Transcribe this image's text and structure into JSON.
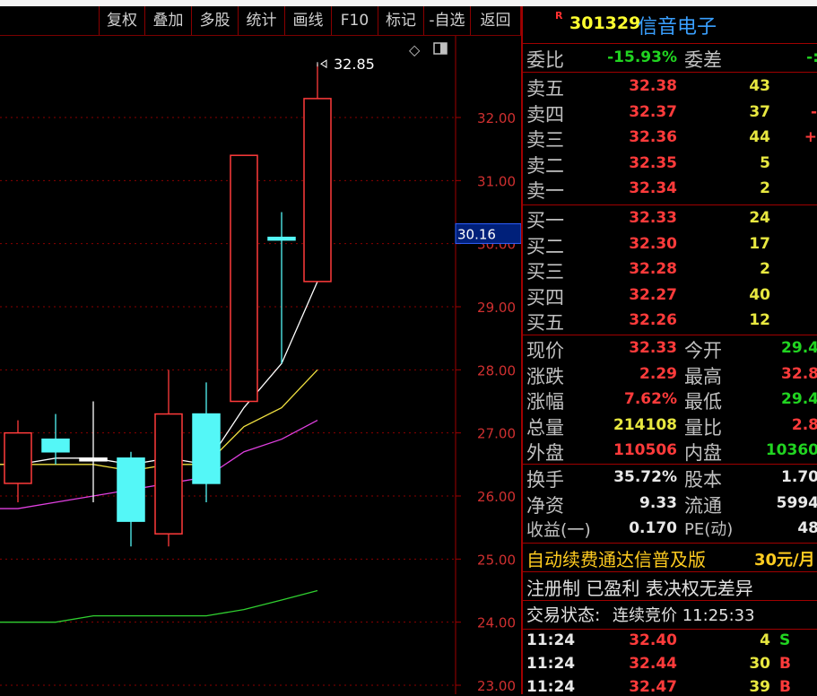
{
  "toolbar": [
    "复权",
    "叠加",
    "多股",
    "统计",
    "画线",
    "F10",
    "标记",
    "-自选",
    "返回"
  ],
  "chart_icons": {
    "diamond": "◇",
    "panel": "panel-toggle-icon"
  },
  "chart_data": {
    "type": "candlestick",
    "y_ticks": [
      "32.00",
      "31.00",
      "30.00",
      "29.00",
      "28.00",
      "27.00",
      "26.00",
      "25.00",
      "24.00",
      "23.00"
    ],
    "y_range": [
      23.0,
      32.0
    ],
    "current_price_tag": "30.16",
    "high_label": "32.85",
    "candles": [
      {
        "open": 26.2,
        "close": 27.0,
        "high": 27.2,
        "low": 25.9,
        "color": "red"
      },
      {
        "open": 26.7,
        "close": 26.9,
        "high": 27.3,
        "low": 26.5,
        "color": "cyan"
      },
      {
        "open": 26.6,
        "close": 26.6,
        "high": 27.5,
        "low": 25.9,
        "color": "white"
      },
      {
        "open": 26.6,
        "close": 25.6,
        "high": 26.7,
        "low": 25.2,
        "color": "cyan"
      },
      {
        "open": 25.4,
        "close": 27.3,
        "high": 28.0,
        "low": 25.2,
        "color": "red"
      },
      {
        "open": 27.3,
        "close": 26.2,
        "high": 27.8,
        "low": 25.9,
        "color": "cyan"
      },
      {
        "open": 27.5,
        "close": 31.4,
        "high": 31.4,
        "low": 27.5,
        "color": "red"
      },
      {
        "open": 30.1,
        "close": 30.1,
        "high": 30.5,
        "low": 28.1,
        "color": "cyan"
      },
      {
        "open": 29.4,
        "close": 32.3,
        "high": 32.85,
        "low": 29.4,
        "color": "red"
      }
    ],
    "ma_lines": [
      {
        "color": "#ffffff",
        "values": [
          26.5,
          26.6,
          26.6,
          26.5,
          26.6,
          26.5,
          27.4,
          28.1,
          29.4
        ]
      },
      {
        "color": "#f0e040",
        "values": [
          26.5,
          26.5,
          26.5,
          26.4,
          26.5,
          26.5,
          27.1,
          27.4,
          28.0
        ]
      },
      {
        "color": "#e040e0",
        "values": [
          25.8,
          25.9,
          26.0,
          26.1,
          26.2,
          26.3,
          26.7,
          26.9,
          27.2
        ]
      },
      {
        "color": "#30d030",
        "values": [
          24.0,
          24.0,
          24.1,
          24.1,
          24.1,
          24.1,
          24.2,
          24.35,
          24.5
        ]
      }
    ]
  },
  "stock": {
    "marker": "R",
    "code": "301329",
    "name": "信音电子"
  },
  "weibi": {
    "label1": "委比",
    "value": "-15.93%",
    "label2": "委差",
    "value2": "-:"
  },
  "asks": [
    {
      "label": "卖五",
      "price": "32.38",
      "vol": "43",
      "extra": ""
    },
    {
      "label": "卖四",
      "price": "32.37",
      "vol": "37",
      "extra": "-"
    },
    {
      "label": "卖三",
      "price": "32.36",
      "vol": "44",
      "extra": "+"
    },
    {
      "label": "卖二",
      "price": "32.35",
      "vol": "5",
      "extra": ""
    },
    {
      "label": "卖一",
      "price": "32.34",
      "vol": "2",
      "extra": ""
    }
  ],
  "bids": [
    {
      "label": "买一",
      "price": "32.33",
      "vol": "24"
    },
    {
      "label": "买二",
      "price": "32.30",
      "vol": "17"
    },
    {
      "label": "买三",
      "price": "32.28",
      "vol": "2"
    },
    {
      "label": "买四",
      "price": "32.27",
      "vol": "40"
    },
    {
      "label": "买五",
      "price": "32.26",
      "vol": "12"
    }
  ],
  "quote": [
    {
      "l1": "现价",
      "v1": "32.33",
      "c1": "red",
      "l2": "今开",
      "v2": "29.4",
      "c2": "green"
    },
    {
      "l1": "涨跌",
      "v1": "2.29",
      "c1": "red",
      "l2": "最高",
      "v2": "32.8",
      "c2": "red"
    },
    {
      "l1": "涨幅",
      "v1": "7.62%",
      "c1": "red",
      "l2": "最低",
      "v2": "29.4",
      "c2": "green"
    },
    {
      "l1": "总量",
      "v1": "214108",
      "c1": "yellow",
      "l2": "量比",
      "v2": "2.8",
      "c2": "red"
    },
    {
      "l1": "外盘",
      "v1": "110506",
      "c1": "red",
      "l2": "内盘",
      "v2": "10360",
      "c2": "green"
    }
  ],
  "fund": [
    {
      "l1": "换手",
      "v1": "35.72%",
      "l2": "股本",
      "v2": "1.70"
    },
    {
      "l1": "净资",
      "v1": "9.33",
      "l2": "流通",
      "v2": "5994"
    },
    {
      "l1": "收益(一)",
      "v1": "0.170",
      "l2": "PE(动)",
      "v2": "48"
    }
  ],
  "ad": {
    "text": "自动续费通达信普及版",
    "price": "30元/月"
  },
  "tags": "注册制 已盈利 表决权无差异",
  "status": {
    "label": "交易状态:",
    "value": "连续竞价 11:25:33"
  },
  "ticks": [
    {
      "time": "11:24",
      "price": "32.40",
      "vol": "4",
      "side": "S"
    },
    {
      "time": "11:24",
      "price": "32.44",
      "vol": "30",
      "side": "B"
    },
    {
      "time": "11:24",
      "price": "32.47",
      "vol": "39",
      "side": "B"
    }
  ]
}
